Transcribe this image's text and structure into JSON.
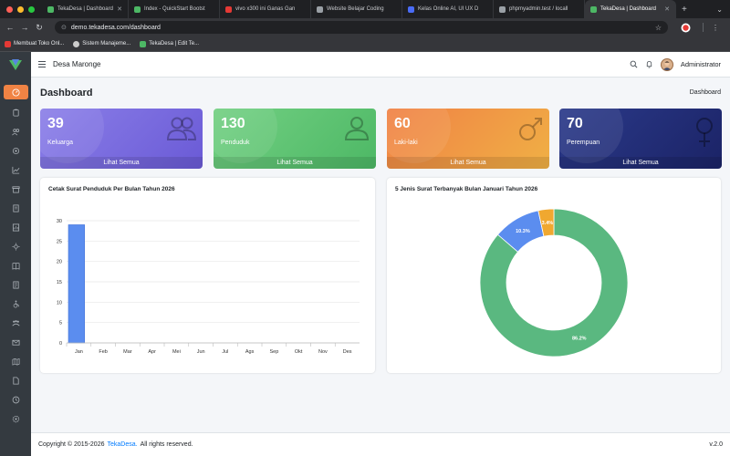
{
  "browser": {
    "tabs": [
      {
        "title": "TekaDesa | Dashboard",
        "color": "#4db865"
      },
      {
        "title": "Index - QuickStart Bootst",
        "color": "#4db865"
      },
      {
        "title": "vivo x300 ini Ganas Gan",
        "color": "#e53935"
      },
      {
        "title": "Website Belajar Coding",
        "color": "#9aa0a6"
      },
      {
        "title": "Kelas Online AI, UI UX D",
        "color": "#4a6cf7"
      },
      {
        "title": "phpmyadmin.test / locall",
        "color": "#9aa0a6"
      },
      {
        "title": "TekaDesa | Dashboard",
        "color": "#4db865"
      }
    ],
    "url": "demo.tekadesa.com/dashboard",
    "bookmarks": [
      {
        "label": "Membuat Toko Onl...",
        "color": "#e53935"
      },
      {
        "label": "Sistem Manajeme...",
        "color": "#cccccc"
      },
      {
        "label": "TekaDesa | Edit Te...",
        "color": "#4db865"
      }
    ]
  },
  "header": {
    "site_name": "Desa Maronge",
    "user_name": "Administrator"
  },
  "page": {
    "title": "Dashboard",
    "breadcrumb": "Dashboard"
  },
  "cards": [
    {
      "value": "39",
      "label": "Keluarga",
      "link": "Lihat Semua",
      "icon": "users-icon"
    },
    {
      "value": "130",
      "label": "Penduduk",
      "link": "Lihat Semua",
      "icon": "user-icon"
    },
    {
      "value": "60",
      "label": "Laki-laki",
      "link": "Lihat Semua",
      "icon": "male-icon"
    },
    {
      "value": "70",
      "label": "Perempuan",
      "link": "Lihat Semua",
      "icon": "female-icon"
    }
  ],
  "chart_data": [
    {
      "type": "bar",
      "title": "Cetak Surat Penduduk Per Bulan Tahun 2026",
      "categories": [
        "Jan",
        "Feb",
        "Mar",
        "Apr",
        "Mei",
        "Jun",
        "Jul",
        "Ags",
        "Sep",
        "Okt",
        "Nov",
        "Des"
      ],
      "values": [
        29,
        0,
        0,
        0,
        0,
        0,
        0,
        0,
        0,
        0,
        0,
        0
      ],
      "yticks": [
        0,
        5,
        10,
        15,
        20,
        25,
        30
      ],
      "ylim": [
        0,
        30
      ],
      "color": "#5b8def"
    },
    {
      "type": "pie",
      "title": "5 Jenis Surat Terbanyak Bulan Januari Tahun 2026",
      "values": [
        86.2,
        10.3,
        3.4
      ],
      "labels": [
        "86.2%",
        "10.3%",
        "3.4%"
      ],
      "colors": [
        "#5ab880",
        "#5b8def",
        "#f0a830"
      ]
    }
  ],
  "footer": {
    "copyright": "Copyright © 2015-2026",
    "brand": "TekaDesa.",
    "rights": "All rights reserved.",
    "version": "v.2.0"
  }
}
